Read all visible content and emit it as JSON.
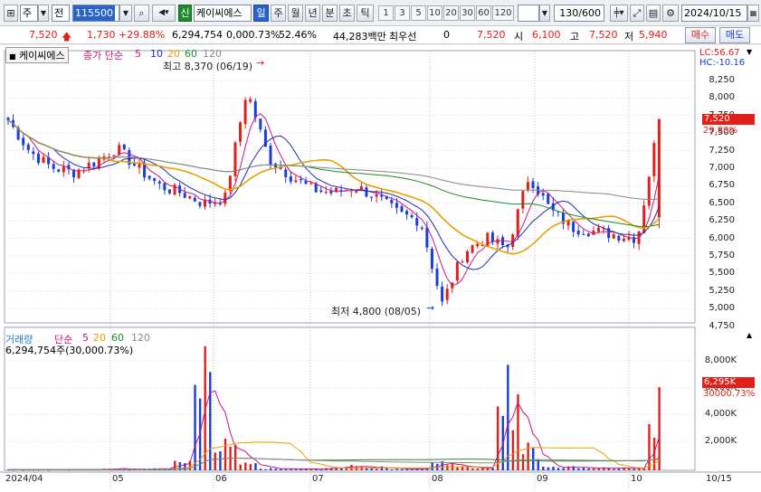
{
  "toolbar": {
    "market_type": "주",
    "order_type": "전",
    "code": "115500",
    "credit_badge": "신",
    "stock_name": "케이씨에스",
    "period_selected": "일",
    "periods": [
      "주",
      "월",
      "년",
      "분",
      "초",
      "틱"
    ],
    "minute_steps": [
      "1",
      "3",
      "5",
      "10",
      "20",
      "30",
      "60",
      "120"
    ],
    "count": "130/600",
    "date": "2024/10/15"
  },
  "quote": {
    "price": "7,520",
    "change": "1,730",
    "change_pct": "+29.88%",
    "volume": "6,294,754",
    "volume_ratio": "0,000.73%",
    "rate": "52.46%",
    "trade_amount": "44,283백만",
    "best_bid_label": "최우선",
    "best_bid": "0",
    "best_bid_price": "7,520",
    "open_label": "시",
    "open": "6,100",
    "high_label": "고",
    "high": "7,520",
    "low_label": "저",
    "low": "5,940",
    "buy_button": "매수",
    "sell_button": "매도"
  },
  "price_panel": {
    "name_tag": "케이씨에스",
    "legend_label": "종가 단순",
    "ma_periods": [
      "5",
      "10",
      "20",
      "60",
      "120"
    ],
    "ma_colors": [
      "#c71585",
      "#1f2ea8",
      "#e8a100",
      "#1e8a2e",
      "#888888"
    ],
    "lc": "LC:56.67",
    "hc": "HC:-10.16",
    "high_annotation": "최고 8,370 (06/19)",
    "low_annotation": "최저 4,800 (08/05)",
    "last_price_tag": "7,520",
    "last_pct_tag": "29.88%",
    "y_ticks": [
      "8,250",
      "8,000",
      "7,750",
      "7,500",
      "7,250",
      "7,000",
      "6,750",
      "6,500",
      "6,250",
      "6,000",
      "5,750",
      "5,500",
      "5,250",
      "5,000",
      "4,750"
    ]
  },
  "volume_panel": {
    "title": "거래량",
    "legend_label": "단순",
    "ma_periods": [
      "5",
      "20",
      "60",
      "120"
    ],
    "summary": "6,294,754주(30,000.73%)",
    "y_ticks": [
      "8,000K",
      "6,000K",
      "4,000K",
      "2,000K"
    ],
    "last_volume_tag": "6,295K",
    "last_ratio_tag": "30000.73%"
  },
  "x_axis": {
    "labels": [
      "2024/04",
      "05",
      "06",
      "07",
      "08",
      "09",
      "10"
    ],
    "right_label": "10/15"
  },
  "chart_data": {
    "type": "candlestick",
    "title": "케이씨에스",
    "high_mark": {
      "price": 8370,
      "date": "06/19"
    },
    "low_mark": {
      "price": 4800,
      "date": "08/05"
    },
    "ylim": [
      4600,
      8350
    ],
    "last": {
      "open": 6100,
      "high": 7520,
      "low": 5940,
      "close": 7520,
      "volume_k": 6295
    },
    "months": [
      "2024/04",
      "05",
      "06",
      "07",
      "08",
      "09",
      "10"
    ],
    "closes_sampled": [
      7500,
      7050,
      6820,
      6750,
      6900,
      7100,
      6800,
      6550,
      6450,
      6300,
      6380,
      7950,
      6950,
      6700,
      6500,
      6450,
      6550,
      6380,
      6150,
      6050,
      4850,
      5600,
      5800,
      5650,
      6700,
      6200,
      5950,
      5900,
      5850,
      5800,
      7520
    ],
    "volume_k_sampled": [
      120,
      80,
      100,
      90,
      150,
      300,
      120,
      200,
      900,
      9400,
      2400,
      700,
      200,
      160,
      140,
      300,
      600,
      350,
      200,
      180,
      900,
      400,
      300,
      8000,
      2100,
      500,
      400,
      300,
      250,
      200,
      6295
    ]
  }
}
